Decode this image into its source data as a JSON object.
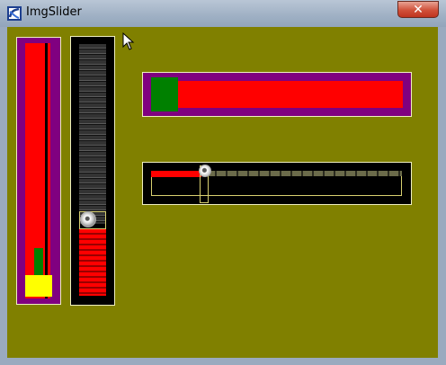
{
  "window": {
    "title": "ImgSlider",
    "close_glyph": "✕",
    "icon": "app-icon"
  },
  "colors": {
    "client_bg": "#808000",
    "purple": "#800080",
    "red": "#ff0000",
    "green": "#008000",
    "yellow": "#ffff00",
    "black": "#000000"
  },
  "sliders": {
    "left_vertical": {
      "orientation": "vertical",
      "value_fraction": 0.08
    },
    "image_vertical": {
      "orientation": "vertical",
      "value_fraction": 0.28
    },
    "top_horizontal": {
      "orientation": "horizontal",
      "value_fraction": 0.0
    },
    "image_horizontal": {
      "orientation": "horizontal",
      "value_fraction": 0.2
    }
  }
}
